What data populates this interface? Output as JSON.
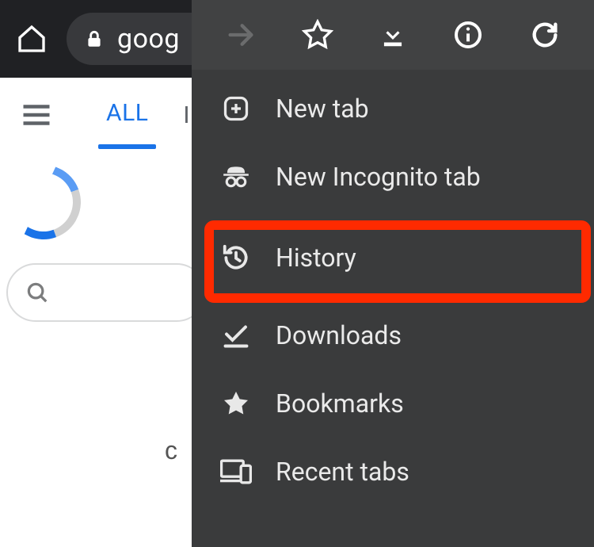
{
  "toolbar": {
    "url_text": "goog"
  },
  "page": {
    "tab_all": "ALL",
    "tab_images": "IM",
    "cut_letter": "c"
  },
  "menu": {
    "items": {
      "new_tab": "New tab",
      "incognito": "New Incognito tab",
      "history": "History",
      "downloads": "Downloads",
      "bookmarks": "Bookmarks",
      "recent_tabs": "Recent tabs"
    }
  }
}
